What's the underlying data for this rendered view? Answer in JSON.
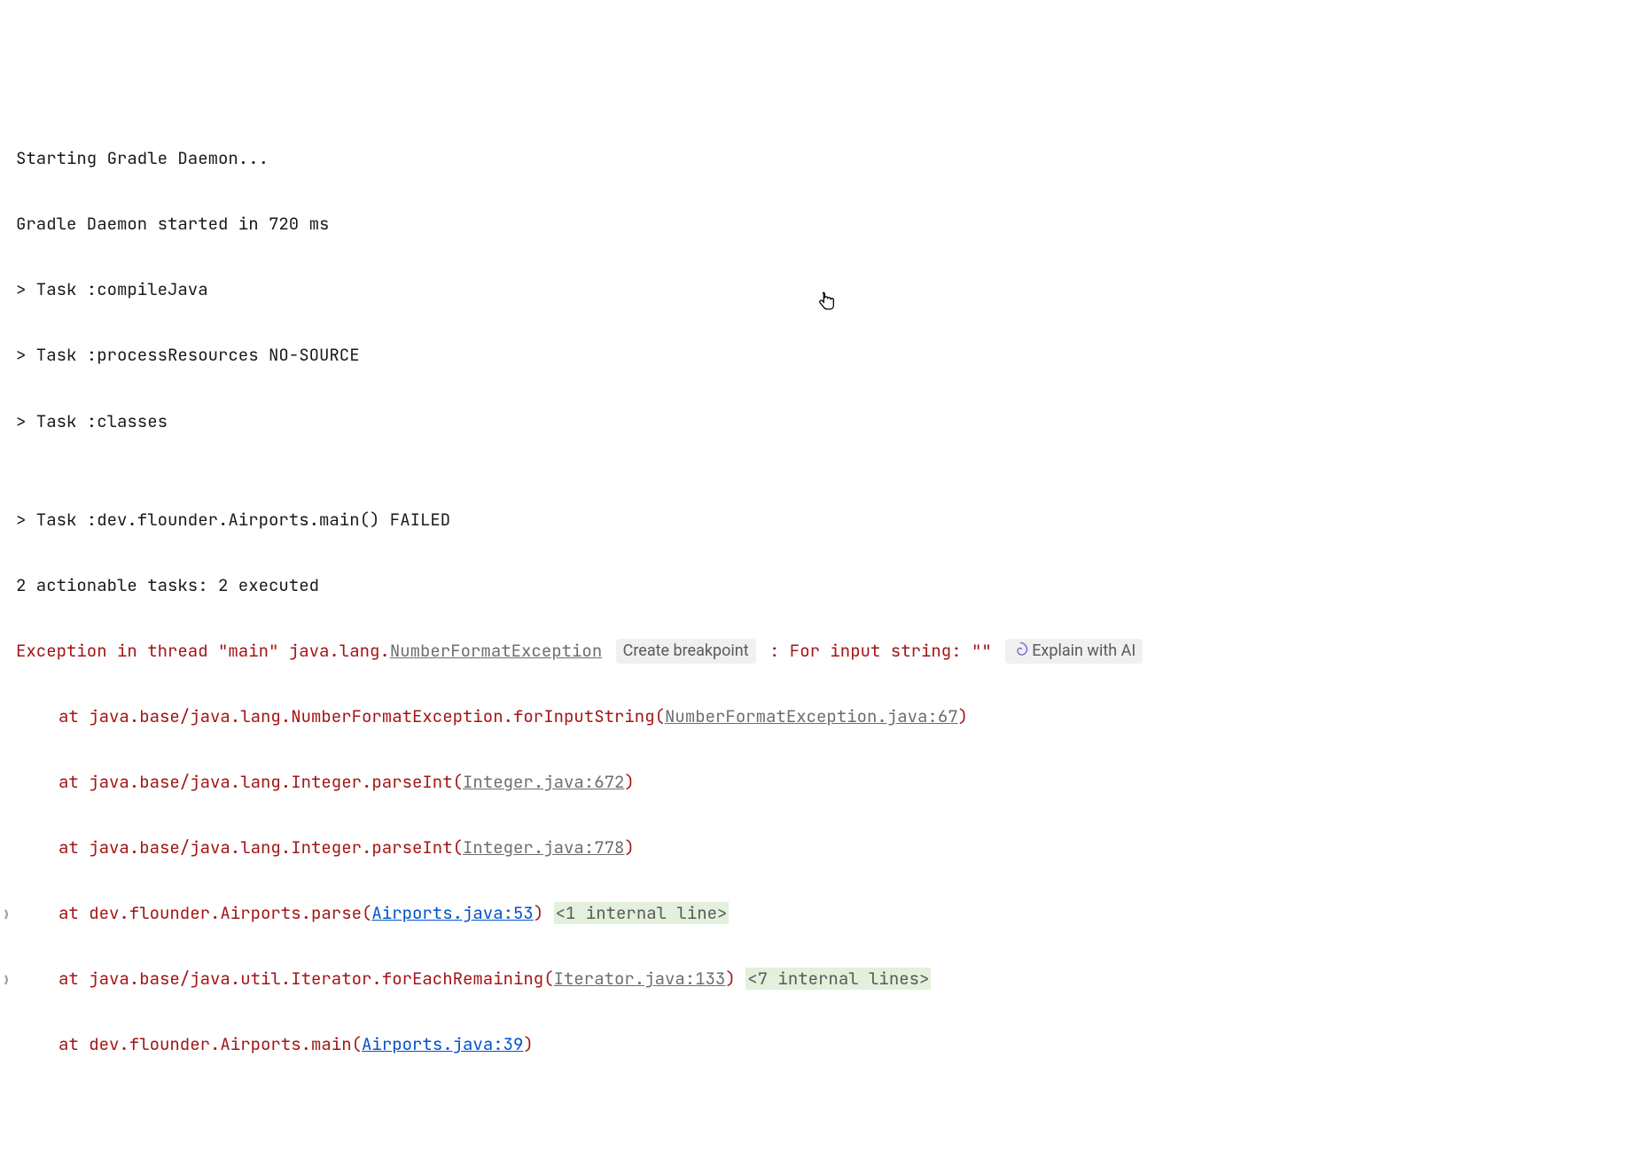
{
  "lines": {
    "l0": "Starting Gradle Daemon...",
    "l1": "Gradle Daemon started in 720 ms",
    "l2": "> Task :compileJava",
    "l3": "> Task :processResources NO-SOURCE",
    "l4": "> Task :classes",
    "l5": "",
    "l6": "> Task :dev.flounder.Airports.main() FAILED",
    "l7": "2 actionable tasks: 2 executed"
  },
  "exc": {
    "prefix": "Exception in thread \"main\" java.lang.",
    "name_link": "NumberFormatException",
    "create_bp": "Create breakpoint",
    "suffix": " : For input string: \"\" ",
    "explain": "Explain with AI"
  },
  "trace": {
    "t0_pre": "at java.base/java.lang.NumberFormatException.forInputString(",
    "t0_link": "NumberFormatException.java:67",
    "t1_pre": "at java.base/java.lang.Integer.parseInt(",
    "t1_link": "Integer.java:672",
    "t2_pre": "at java.base/java.lang.Integer.parseInt(",
    "t2_link": "Integer.java:778",
    "t3_pre": "at dev.flounder.Airports.parse(",
    "t3_link": "Airports.java:53",
    "t3_fold": "<1 internal line>",
    "t4_pre": "at java.base/java.util.Iterator.forEachRemaining(",
    "t4_link": "Iterator.java:133",
    "t4_fold": "<7 internal lines>",
    "t5_pre": "at dev.flounder.Airports.main(",
    "t5_link": "Airports.java:39",
    "close_paren": ")"
  }
}
